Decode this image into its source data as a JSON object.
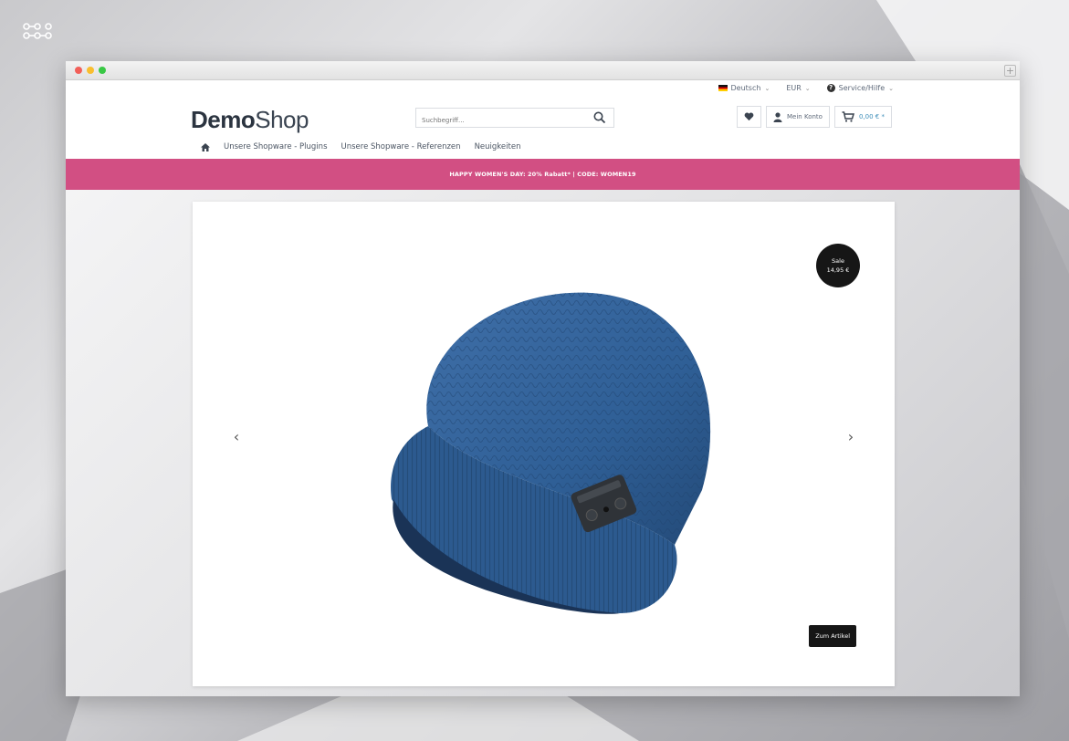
{
  "header": {
    "logo_bold": "Demo",
    "logo_light": "Shop",
    "language": "Deutsch",
    "currency": "EUR",
    "service": "Service/Hilfe",
    "search_placeholder": "Suchbegriff...",
    "account_label": "Mein Konto",
    "cart_total": "0,00 € *"
  },
  "nav": {
    "items": [
      "Unsere Shopware - Plugins",
      "Unsere Shopware - Referenzen",
      "Neuigkeiten"
    ]
  },
  "promo": {
    "text": "HAPPY WOMEN'S DAY: 20% Rabatt* | CODE: WOMEN19",
    "toggle": "^"
  },
  "slider": {
    "prev": "‹",
    "next": "›",
    "badge_label": "Sale",
    "badge_price": "14,95 €",
    "cta_label": "Zum Artikel"
  },
  "colors": {
    "accent_pink": "#d24f83",
    "cart_blue": "#3d8eb9",
    "hat_blue": "#2f5f96",
    "dark": "#161616"
  },
  "icons": {
    "home": "home-icon",
    "search": "search-icon",
    "wishlist": "heart-icon",
    "account": "user-icon",
    "cart": "cart-icon"
  }
}
